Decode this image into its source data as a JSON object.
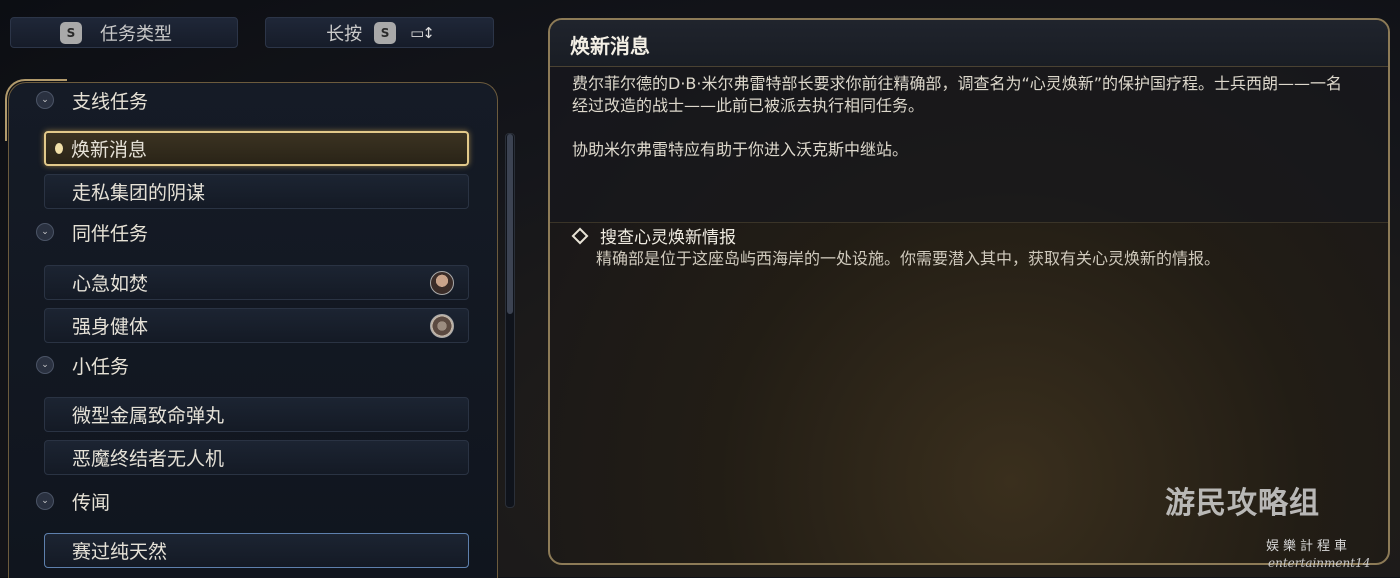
{
  "toolbar": {
    "quest_type": {
      "key": "S",
      "label": "任务类型"
    },
    "sort": {
      "prefix": "长按",
      "key": "S",
      "icon": "sort-icon"
    }
  },
  "quest_list": {
    "categories": [
      {
        "label": "支线任务",
        "items": [
          {
            "label": "焕新消息",
            "selected": true
          },
          {
            "label": "走私集团的阴谋"
          }
        ]
      },
      {
        "label": "同伴任务",
        "items": [
          {
            "label": "心急如焚",
            "avatar": "companion-avatar-1"
          },
          {
            "label": "强身健体",
            "avatar": "companion-avatar-2"
          }
        ]
      },
      {
        "label": "小任务",
        "items": [
          {
            "label": "微型金属致命弹丸"
          },
          {
            "label": "恶魔终结者无人机"
          }
        ]
      },
      {
        "label": "传闻",
        "items": [
          {
            "label": "赛过纯天然"
          }
        ]
      }
    ]
  },
  "detail": {
    "title": "焕新消息",
    "description": [
      "费尔菲尔德的D·B·米尔弗雷特部长要求你前往精确部，调查名为“心灵焕新”的保护国疗程。士兵西朗——一名经过改造的战士——此前已被派去执行相同任务。",
      "协助米尔弗雷特应有助于你进入沃克斯中继站。"
    ],
    "objective": {
      "title": "搜查心灵焕新情报",
      "text": "精确部是位于这座岛屿西海岸的一处设施。你需要潜入其中，获取有关心灵焕新的情报。"
    }
  },
  "watermark": {
    "main": "游民攻略组",
    "logo": "娱樂計程車",
    "sub": "entertainment14"
  },
  "colors": {
    "gold_accent": "#e2c98a",
    "panel_border": "#8d7b57",
    "panel_bg": "#151b26"
  }
}
